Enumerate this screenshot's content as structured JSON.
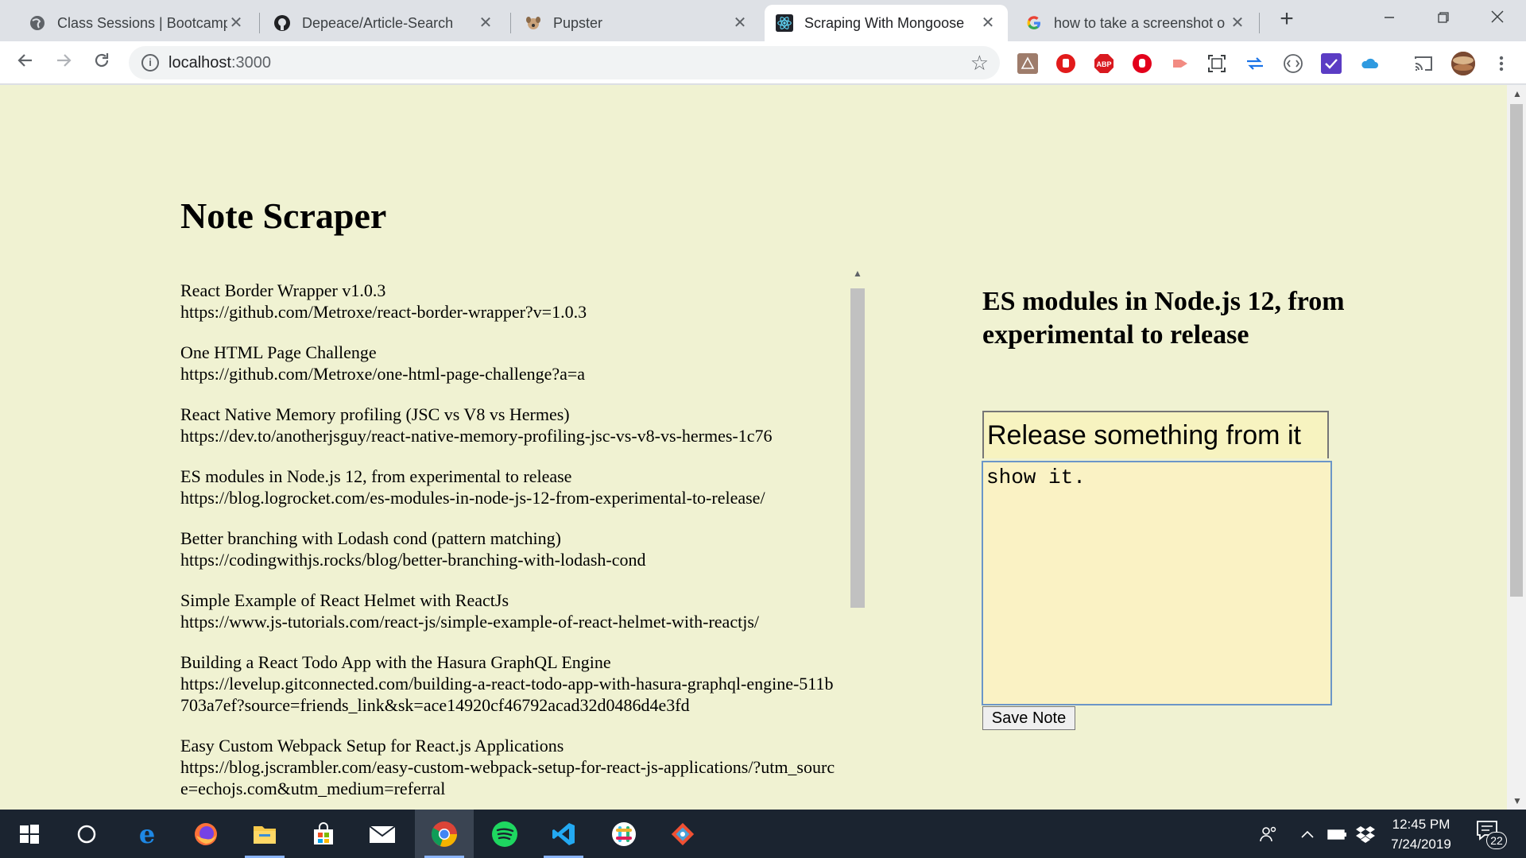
{
  "browser": {
    "tabs": [
      {
        "title": "Class Sessions | Bootcamp S",
        "icon": "globe-icon"
      },
      {
        "title": "Depeace/Article-Search",
        "icon": "github-icon"
      },
      {
        "title": "Pupster",
        "icon": "dog-icon"
      },
      {
        "title": "Scraping With Mongoose",
        "icon": "react-icon",
        "active": true
      },
      {
        "title": "how to take a screenshot o",
        "icon": "google-icon"
      }
    ],
    "new_tab": "+",
    "close_glyph": "✕",
    "url_host": "localhost",
    "url_port": ":3000",
    "star": "☆",
    "info": "i",
    "ext_abp": "ABP"
  },
  "page": {
    "title": "Note Scraper",
    "articles": [
      {
        "title": "React Border Wrapper v1.0.3",
        "link": "https://github.com/Metroxe/react-border-wrapper?v=1.0.3"
      },
      {
        "title": "One HTML Page Challenge",
        "link": "https://github.com/Metroxe/one-html-page-challenge?a=a"
      },
      {
        "title": "React Native Memory profiling (JSC vs V8 vs Hermes)",
        "link": "https://dev.to/anotherjsguy/react-native-memory-profiling-jsc-vs-v8-vs-hermes-1c76"
      },
      {
        "title": "ES modules in Node.js 12, from experimental to release",
        "link": "https://blog.logrocket.com/es-modules-in-node-js-12-from-experimental-to-release/"
      },
      {
        "title": "Better branching with Lodash cond (pattern matching)",
        "link": "https://codingwithjs.rocks/blog/better-branching-with-lodash-cond"
      },
      {
        "title": "Simple Example of React Helmet with ReactJs",
        "link": "https://www.js-tutorials.com/react-js/simple-example-of-react-helmet-with-reactjs/"
      },
      {
        "title": "Building a React Todo App with the Hasura GraphQL Engine",
        "link": "https://levelup.gitconnected.com/building-a-react-todo-app-with-hasura-graphql-engine-511b703a7ef?source=friends_link&sk=ace14920cf46792acad32d0486d4e3fd"
      },
      {
        "title": "Easy Custom Webpack Setup for React.js Applications",
        "link": "https://blog.jscrambler.com/easy-custom-webpack-setup-for-react-js-applications/?utm_source=echojs.com&utm_medium=referral"
      }
    ],
    "note": {
      "heading": "ES modules in Node.js 12, from experimental to release",
      "title_value": "Release something from it",
      "body_value": "show it.",
      "save_label": "Save Note"
    }
  },
  "taskbar": {
    "time": "12:45 PM",
    "date": "7/24/2019",
    "notification_count": "22",
    "apps": [
      "start-icon",
      "cortana-icon",
      "edge-icon",
      "firefox-icon",
      "file-explorer-icon",
      "store-icon",
      "mail-icon",
      "chrome-icon",
      "spotify-icon",
      "vscode-icon",
      "slack-icon",
      "git-icon"
    ]
  },
  "colors": {
    "page_background": "#f0f2d2",
    "note_background": "#faf2c4",
    "taskbar": "#1b2430"
  }
}
